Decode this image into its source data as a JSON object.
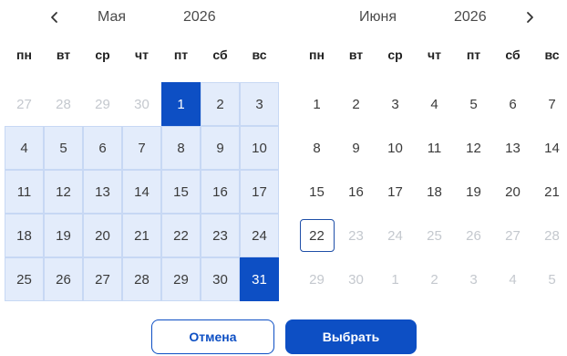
{
  "left_calendar": {
    "month": "Мая",
    "year": "2026",
    "weekdays": [
      "пн",
      "вт",
      "ср",
      "чт",
      "пт",
      "сб",
      "вс"
    ],
    "weeks": [
      [
        {
          "d": "27",
          "s": "muted"
        },
        {
          "d": "28",
          "s": "muted"
        },
        {
          "d": "29",
          "s": "muted"
        },
        {
          "d": "30",
          "s": "muted"
        },
        {
          "d": "1",
          "s": "selected"
        },
        {
          "d": "2",
          "s": "range"
        },
        {
          "d": "3",
          "s": "range"
        }
      ],
      [
        {
          "d": "4",
          "s": "range"
        },
        {
          "d": "5",
          "s": "range"
        },
        {
          "d": "6",
          "s": "range"
        },
        {
          "d": "7",
          "s": "range"
        },
        {
          "d": "8",
          "s": "range"
        },
        {
          "d": "9",
          "s": "range"
        },
        {
          "d": "10",
          "s": "range"
        }
      ],
      [
        {
          "d": "11",
          "s": "range"
        },
        {
          "d": "12",
          "s": "range"
        },
        {
          "d": "13",
          "s": "range"
        },
        {
          "d": "14",
          "s": "range"
        },
        {
          "d": "15",
          "s": "range"
        },
        {
          "d": "16",
          "s": "range"
        },
        {
          "d": "17",
          "s": "range"
        }
      ],
      [
        {
          "d": "18",
          "s": "range"
        },
        {
          "d": "19",
          "s": "range"
        },
        {
          "d": "20",
          "s": "range"
        },
        {
          "d": "21",
          "s": "range"
        },
        {
          "d": "22",
          "s": "range"
        },
        {
          "d": "23",
          "s": "range"
        },
        {
          "d": "24",
          "s": "range"
        }
      ],
      [
        {
          "d": "25",
          "s": "range"
        },
        {
          "d": "26",
          "s": "range"
        },
        {
          "d": "27",
          "s": "range"
        },
        {
          "d": "28",
          "s": "range"
        },
        {
          "d": "29",
          "s": "range"
        },
        {
          "d": "30",
          "s": "range"
        },
        {
          "d": "31",
          "s": "selected"
        }
      ]
    ]
  },
  "right_calendar": {
    "month": "Июня",
    "year": "2026",
    "weekdays": [
      "пн",
      "вт",
      "ср",
      "чт",
      "пт",
      "сб",
      "вс"
    ],
    "weeks": [
      [
        {
          "d": "1",
          "s": "normal"
        },
        {
          "d": "2",
          "s": "normal"
        },
        {
          "d": "3",
          "s": "normal"
        },
        {
          "d": "4",
          "s": "normal"
        },
        {
          "d": "5",
          "s": "normal"
        },
        {
          "d": "6",
          "s": "normal"
        },
        {
          "d": "7",
          "s": "normal"
        }
      ],
      [
        {
          "d": "8",
          "s": "normal"
        },
        {
          "d": "9",
          "s": "normal"
        },
        {
          "d": "10",
          "s": "normal"
        },
        {
          "d": "11",
          "s": "normal"
        },
        {
          "d": "12",
          "s": "normal"
        },
        {
          "d": "13",
          "s": "normal"
        },
        {
          "d": "14",
          "s": "normal"
        }
      ],
      [
        {
          "d": "15",
          "s": "normal"
        },
        {
          "d": "16",
          "s": "normal"
        },
        {
          "d": "17",
          "s": "normal"
        },
        {
          "d": "18",
          "s": "normal"
        },
        {
          "d": "19",
          "s": "normal"
        },
        {
          "d": "20",
          "s": "normal"
        },
        {
          "d": "21",
          "s": "normal"
        }
      ],
      [
        {
          "d": "22",
          "s": "today"
        },
        {
          "d": "23",
          "s": "muted"
        },
        {
          "d": "24",
          "s": "muted"
        },
        {
          "d": "25",
          "s": "muted"
        },
        {
          "d": "26",
          "s": "muted"
        },
        {
          "d": "27",
          "s": "muted"
        },
        {
          "d": "28",
          "s": "muted"
        }
      ],
      [
        {
          "d": "29",
          "s": "muted"
        },
        {
          "d": "30",
          "s": "muted"
        },
        {
          "d": "1",
          "s": "muted"
        },
        {
          "d": "2",
          "s": "muted"
        },
        {
          "d": "3",
          "s": "muted"
        },
        {
          "d": "4",
          "s": "muted"
        },
        {
          "d": "5",
          "s": "muted"
        }
      ]
    ]
  },
  "nav": {
    "prev_icon": "chevron-left-icon",
    "next_icon": "chevron-right-icon"
  },
  "actions": {
    "cancel_label": "Отмена",
    "confirm_label": "Выбрать"
  },
  "colors": {
    "accent": "#0d4fc4",
    "range_bg": "#e3ecfb",
    "muted_text": "#c4c8ce"
  }
}
